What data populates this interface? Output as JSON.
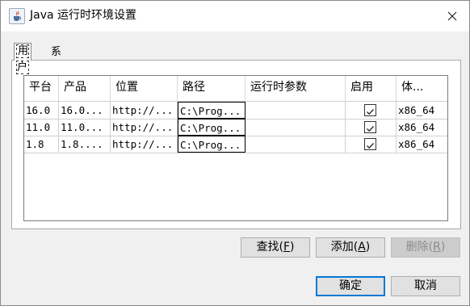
{
  "window": {
    "title": "Java 运行时环境设置"
  },
  "tabs": [
    {
      "label": "用户"
    },
    {
      "label": "系统"
    }
  ],
  "table": {
    "columns": [
      "平台",
      "产品",
      "位置",
      "路径",
      "运行时参数",
      "启用",
      "体..."
    ],
    "rows": [
      {
        "platform": "16.0",
        "product": "16.0...",
        "location": "http://...",
        "path": "C:\\Prog...",
        "args": "",
        "enabled": true,
        "arch": "x86_64"
      },
      {
        "platform": "11.0",
        "product": "11.0...",
        "location": "http://...",
        "path": "C:\\Prog...",
        "args": "",
        "enabled": true,
        "arch": "x86_64"
      },
      {
        "platform": "1.8",
        "product": "1.8....",
        "location": "http://...",
        "path": "C:\\Prog...",
        "args": "",
        "enabled": true,
        "arch": "x86_64"
      }
    ]
  },
  "buttons": {
    "find": {
      "label": "查找",
      "mnemonic": "F"
    },
    "add": {
      "label": "添加",
      "mnemonic": "A"
    },
    "remove": {
      "label": "删除",
      "mnemonic": "R"
    },
    "ok": "确定",
    "cancel": "取消"
  },
  "icons": {
    "app": "java-cup-icon",
    "close": "close-icon",
    "check": "checkmark-icon"
  },
  "colors": {
    "default_button_border": "#0078d7",
    "disabled_text": "#8c8c8c"
  }
}
